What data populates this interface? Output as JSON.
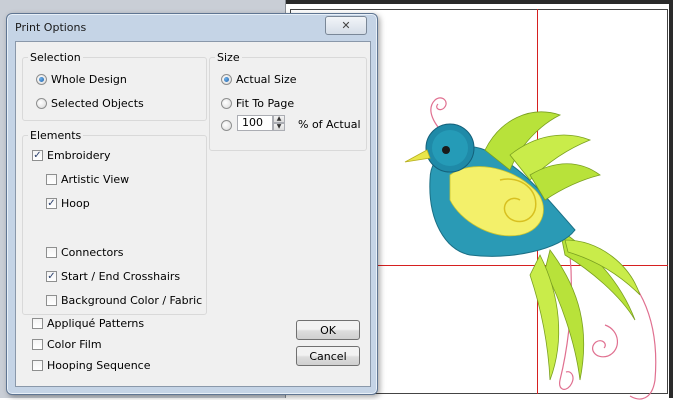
{
  "dialog": {
    "title": "Print Options",
    "close_glyph": "✕",
    "selection": {
      "label": "Selection",
      "options": [
        {
          "label": "Whole Design",
          "selected": true
        },
        {
          "label": "Selected Objects",
          "selected": false
        }
      ]
    },
    "size": {
      "label": "Size",
      "options": [
        {
          "label": "Actual Size",
          "selected": true
        },
        {
          "label": "Fit To Page",
          "selected": false
        }
      ],
      "percent_value": "100",
      "percent_suffix": "% of Actual"
    },
    "elements": {
      "label": "Elements",
      "items": [
        {
          "label": "Embroidery",
          "checked": true
        },
        {
          "label": "Artistic View",
          "checked": false
        },
        {
          "label": "Hoop",
          "checked": true
        },
        {
          "label": "Connectors",
          "checked": false
        },
        {
          "label": "Start / End Crosshairs",
          "checked": true
        },
        {
          "label": "Background Color / Fabric",
          "checked": false
        }
      ]
    },
    "extras": [
      {
        "label": "Appliqué Patterns",
        "checked": false
      },
      {
        "label": "Color Film",
        "checked": false
      },
      {
        "label": "Hooping Sequence",
        "checked": false
      }
    ],
    "ok_label": "OK",
    "cancel_label": "Cancel"
  },
  "colors": {
    "crosshair": "#d62020",
    "dialog_frame": "#c5d4e6",
    "bird_blue": "#2a9ab5",
    "bird_yellow": "#f3f06a",
    "bird_green": "#b8e23a"
  }
}
